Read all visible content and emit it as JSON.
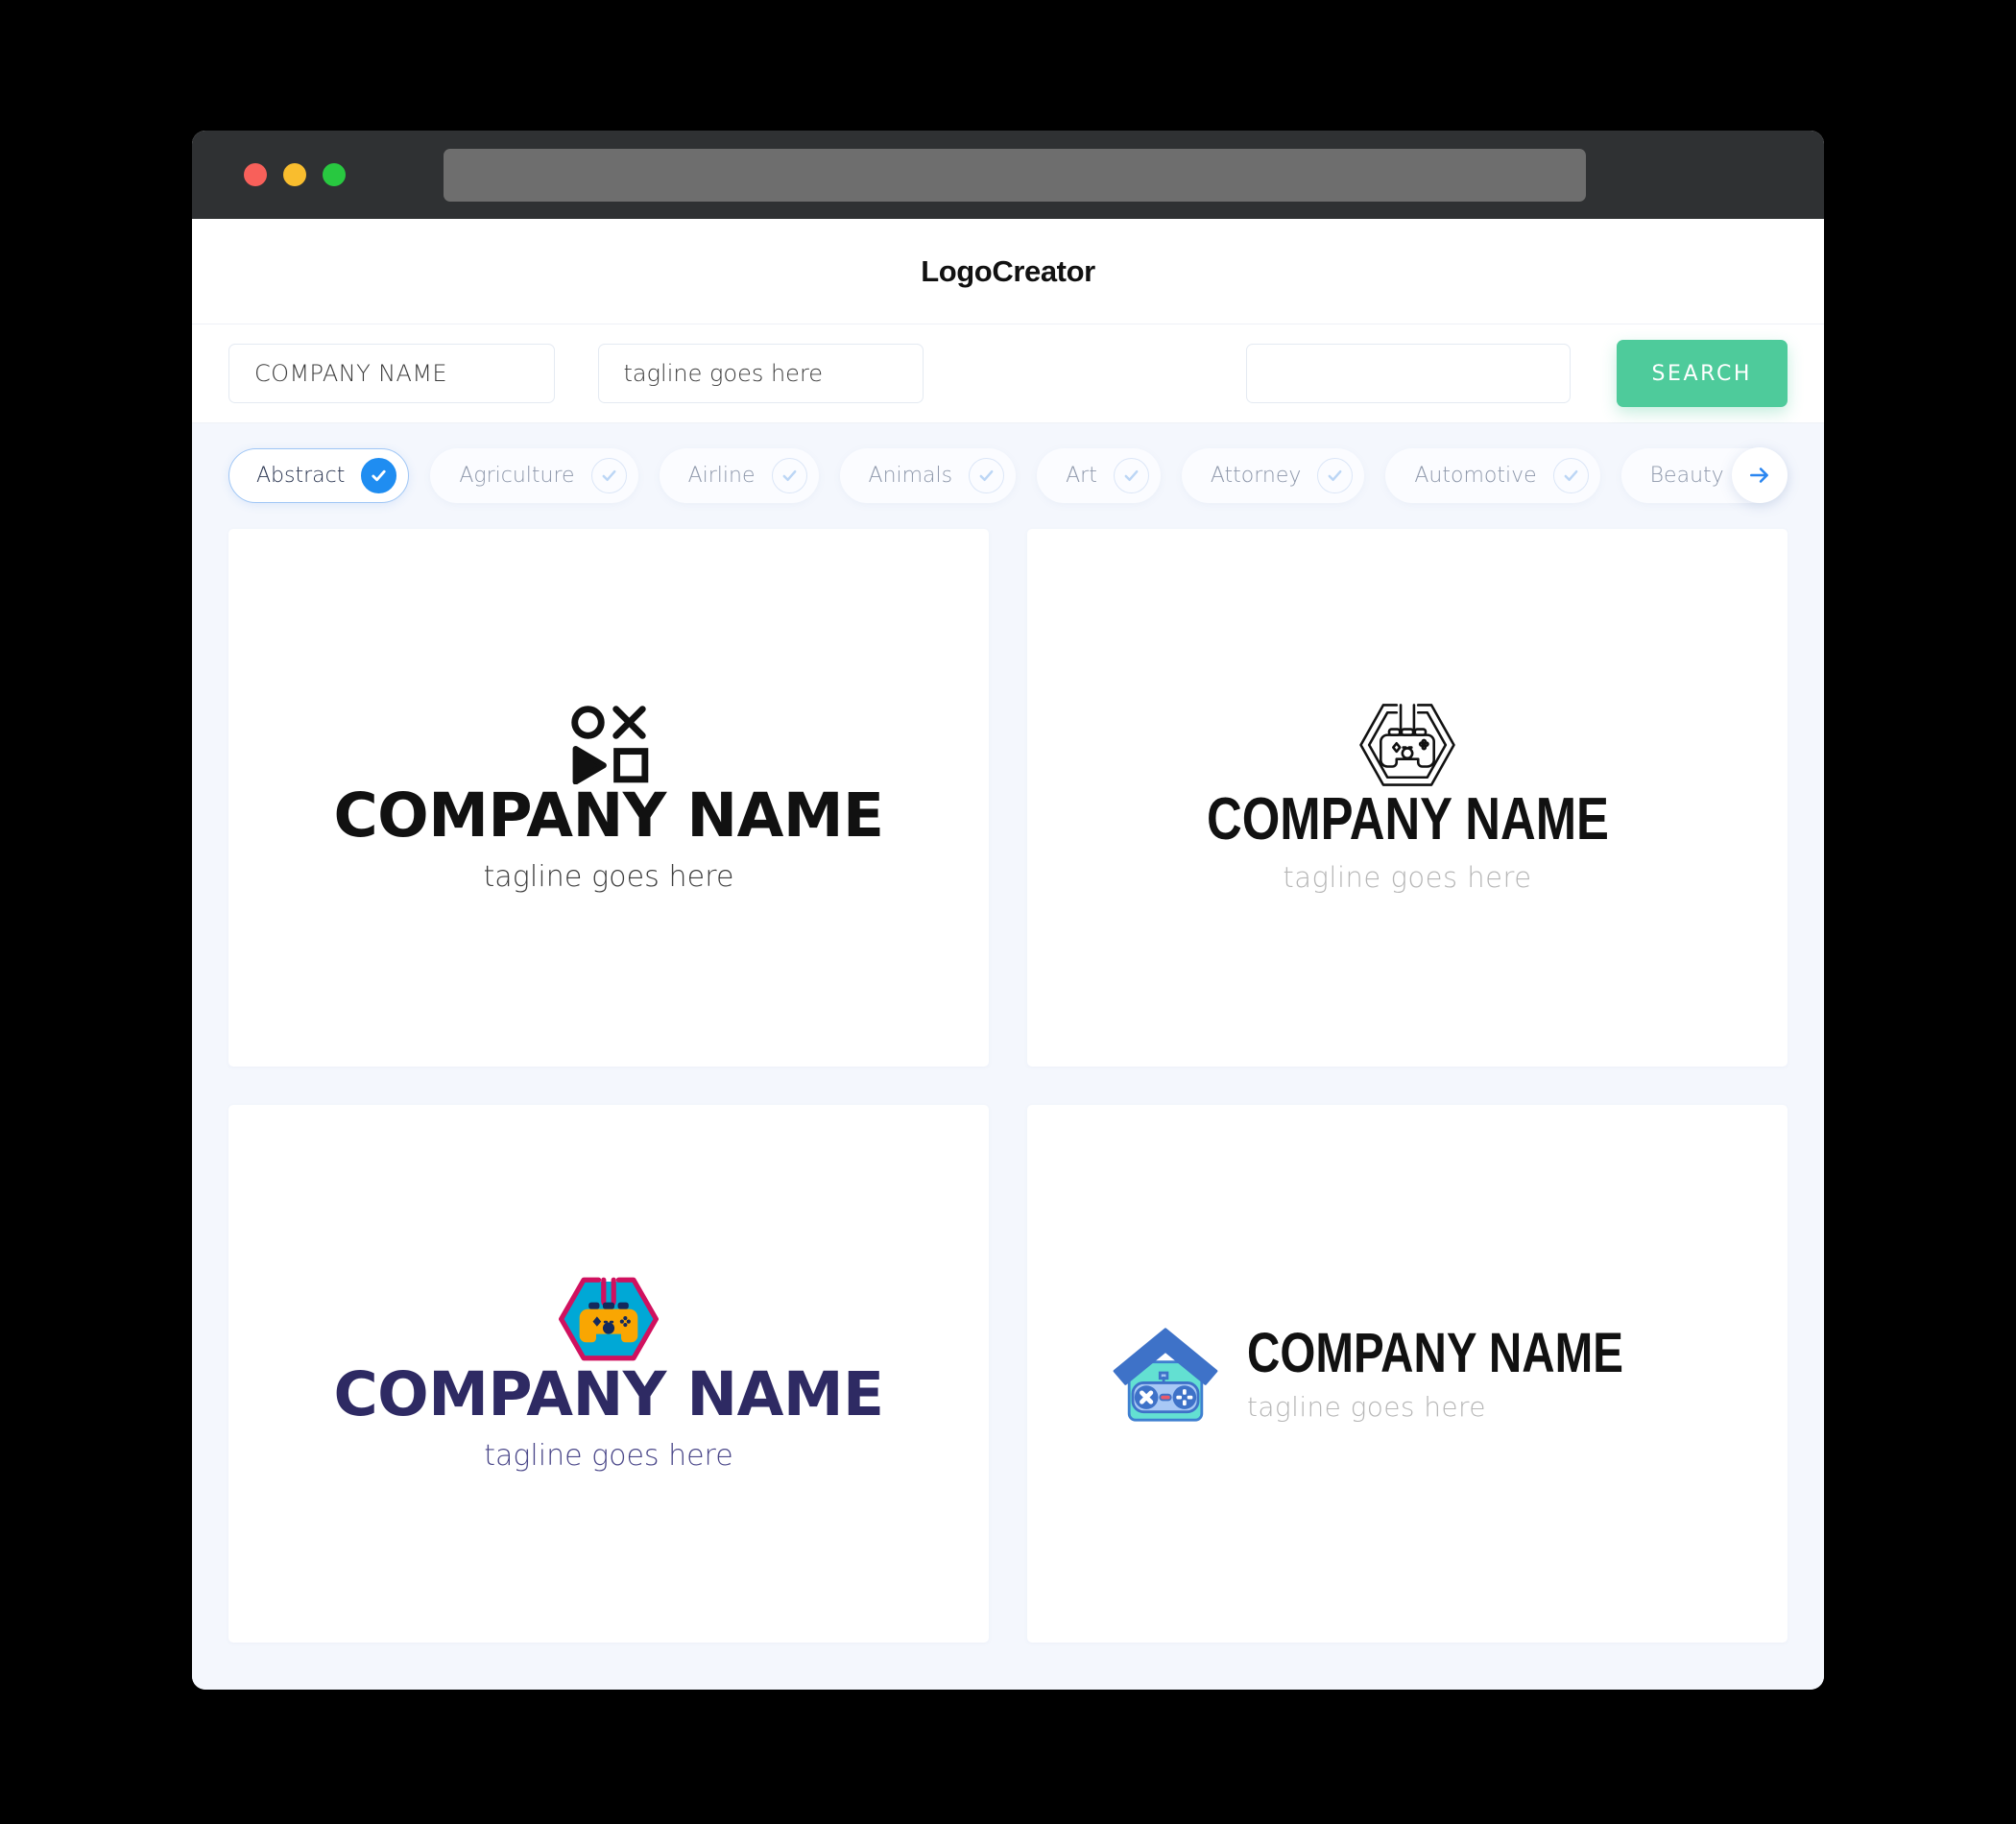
{
  "window": {
    "traffic_lights": [
      "close-red",
      "minimize-yellow",
      "maximize-green"
    ],
    "url_value": ""
  },
  "header": {
    "title": "LogoCreator"
  },
  "search": {
    "company_value": "COMPANY NAME",
    "company_placeholder": "COMPANY NAME",
    "tagline_value": "tagline goes here",
    "tagline_placeholder": "tagline goes here",
    "extra_value": "",
    "extra_placeholder": "",
    "button_label": "SEARCH",
    "button_color": "#4ecb9b"
  },
  "categories": {
    "selected": "Abstract",
    "selected_color": "#1f8df1",
    "next_arrow": "arrow-right-icon",
    "items": [
      {
        "label": "Abstract",
        "selected": true
      },
      {
        "label": "Agriculture",
        "selected": false
      },
      {
        "label": "Airline",
        "selected": false
      },
      {
        "label": "Animals",
        "selected": false
      },
      {
        "label": "Art",
        "selected": false
      },
      {
        "label": "Attorney",
        "selected": false
      },
      {
        "label": "Automotive",
        "selected": false
      },
      {
        "label": "Beauty",
        "selected": false
      }
    ]
  },
  "results": [
    {
      "icon": "playstation-shapes-icon",
      "name": "COMPANY NAME",
      "tagline": "tagline goes here",
      "name_color": "#111111",
      "tagline_color": "#3c3c3c"
    },
    {
      "icon": "hexagon-gamepad-outline-icon",
      "name": "COMPANY NAME",
      "tagline": "tagline goes here",
      "name_color": "#111111",
      "tagline_color": "#b6b6b6"
    },
    {
      "icon": "hexagon-gamepad-color-icon",
      "name": "COMPANY NAME",
      "tagline": "tagline goes here",
      "name_color": "#2e2a63",
      "tagline_color": "#4a4789"
    },
    {
      "icon": "house-gamepad-icon",
      "name": "COMPANY NAME",
      "tagline": "tagline goes here",
      "name_color": "#111111",
      "tagline_color": "#b6b6b6"
    }
  ]
}
